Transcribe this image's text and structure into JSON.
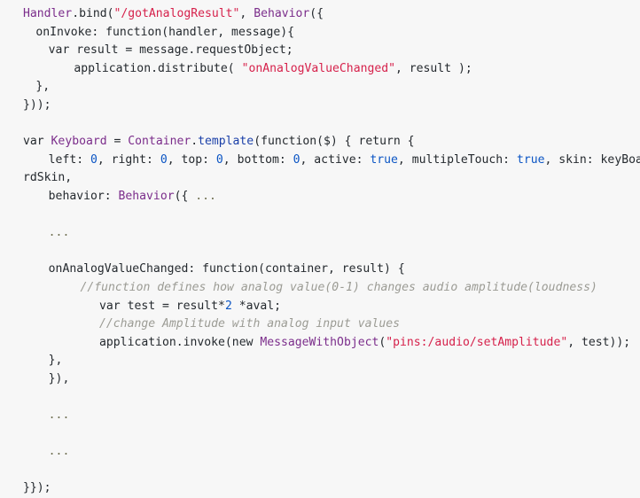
{
  "editor": {
    "background_color": "#f7f7f7",
    "font_size_px": 13,
    "language": "JavaScript"
  },
  "colors": {
    "plain": "#24292e",
    "type": "#7b2d8b",
    "method": "#1a3fa8",
    "string": "#d6214b",
    "number": "#0b55c4",
    "comment": "#9b9b94",
    "brace": "#5c5c2e"
  },
  "code": {
    "lines": [
      {
        "id": "line-1",
        "indent": 0,
        "tokens": [
          {
            "t": "Handler",
            "c": "type"
          },
          {
            "t": ".bind(",
            "c": "plain"
          },
          {
            "t": "\"/gotAnalogResult\"",
            "c": "string"
          },
          {
            "t": ", ",
            "c": "plain"
          },
          {
            "t": "Behavior",
            "c": "type"
          },
          {
            "t": "({",
            "c": "plain"
          }
        ]
      },
      {
        "id": "line-2",
        "indent": 2,
        "tokens": [
          {
            "t": "onInvoke: function(handler, message){",
            "c": "plain"
          }
        ]
      },
      {
        "id": "line-3",
        "indent": 4,
        "tokens": [
          {
            "t": "var result = message.requestObject;",
            "c": "plain"
          }
        ]
      },
      {
        "id": "line-4",
        "indent": 8,
        "tokens": [
          {
            "t": "application.distribute( ",
            "c": "plain"
          },
          {
            "t": "\"onAnalogValueChanged\"",
            "c": "string"
          },
          {
            "t": ", result );",
            "c": "plain"
          }
        ]
      },
      {
        "id": "line-5",
        "indent": 2,
        "tokens": [
          {
            "t": "},",
            "c": "plain"
          }
        ]
      },
      {
        "id": "line-6",
        "indent": 0,
        "tokens": [
          {
            "t": "}));",
            "c": "plain"
          }
        ]
      },
      {
        "id": "line-7",
        "indent": 0,
        "tokens": []
      },
      {
        "id": "line-8",
        "indent": 0,
        "tokens": [
          {
            "t": "var ",
            "c": "plain"
          },
          {
            "t": "Keyboard",
            "c": "type"
          },
          {
            "t": " = ",
            "c": "plain"
          },
          {
            "t": "Container",
            "c": "type"
          },
          {
            "t": ".",
            "c": "plain"
          },
          {
            "t": "template",
            "c": "method"
          },
          {
            "t": "(function($) { return {",
            "c": "plain"
          }
        ]
      },
      {
        "id": "line-9",
        "indent": 4,
        "tokens": [
          {
            "t": "left: ",
            "c": "plain"
          },
          {
            "t": "0",
            "c": "number"
          },
          {
            "t": ", right: ",
            "c": "plain"
          },
          {
            "t": "0",
            "c": "number"
          },
          {
            "t": ", top: ",
            "c": "plain"
          },
          {
            "t": "0",
            "c": "number"
          },
          {
            "t": ", bottom: ",
            "c": "plain"
          },
          {
            "t": "0",
            "c": "number"
          },
          {
            "t": ", active: ",
            "c": "plain"
          },
          {
            "t": "true",
            "c": "number"
          },
          {
            "t": ", multipleTouch: ",
            "c": "plain"
          },
          {
            "t": "true",
            "c": "number"
          },
          {
            "t": ", skin: keyBoa",
            "c": "plain"
          }
        ]
      },
      {
        "id": "line-10",
        "indent": 0,
        "tokens": [
          {
            "t": "rdSkin,",
            "c": "plain"
          }
        ]
      },
      {
        "id": "line-11",
        "indent": 4,
        "tokens": [
          {
            "t": "behavior: ",
            "c": "plain"
          },
          {
            "t": "Behavior",
            "c": "type"
          },
          {
            "t": "({ ",
            "c": "plain"
          },
          {
            "t": "...",
            "c": "dots"
          }
        ]
      },
      {
        "id": "line-12",
        "indent": 0,
        "tokens": []
      },
      {
        "id": "line-13",
        "indent": 4,
        "tokens": [
          {
            "t": "...",
            "c": "dots"
          }
        ]
      },
      {
        "id": "line-14",
        "indent": 0,
        "tokens": []
      },
      {
        "id": "line-15",
        "indent": 4,
        "tokens": [
          {
            "t": "onAnalogValueChanged: function(container, result) {",
            "c": "plain"
          }
        ]
      },
      {
        "id": "line-16",
        "indent": 9,
        "tokens": [
          {
            "t": "//function defines how analog value(0-1) changes audio amplitude(loudness)",
            "c": "comment"
          }
        ]
      },
      {
        "id": "line-17",
        "indent": 12,
        "tokens": [
          {
            "t": "var test = result*",
            "c": "plain"
          },
          {
            "t": "2",
            "c": "number"
          },
          {
            "t": " *aval;",
            "c": "plain"
          }
        ]
      },
      {
        "id": "line-18",
        "indent": 12,
        "tokens": [
          {
            "t": "//change Amplitude with analog input values",
            "c": "comment"
          }
        ]
      },
      {
        "id": "line-19",
        "indent": 12,
        "tokens": [
          {
            "t": "application.invoke(new ",
            "c": "plain"
          },
          {
            "t": "MessageWithObject",
            "c": "type"
          },
          {
            "t": "(",
            "c": "plain"
          },
          {
            "t": "\"pins:/audio/setAmplitude\"",
            "c": "string"
          },
          {
            "t": ", test));",
            "c": "plain"
          }
        ]
      },
      {
        "id": "line-20",
        "indent": 4,
        "tokens": [
          {
            "t": "},",
            "c": "plain"
          }
        ]
      },
      {
        "id": "line-21",
        "indent": 4,
        "tokens": [
          {
            "t": "}),",
            "c": "plain"
          }
        ]
      },
      {
        "id": "line-22",
        "indent": 0,
        "tokens": []
      },
      {
        "id": "line-23",
        "indent": 4,
        "tokens": [
          {
            "t": "...",
            "c": "dots"
          }
        ]
      },
      {
        "id": "line-24",
        "indent": 0,
        "tokens": []
      },
      {
        "id": "line-25",
        "indent": 4,
        "tokens": [
          {
            "t": "...",
            "c": "dots"
          }
        ]
      },
      {
        "id": "line-26",
        "indent": 0,
        "tokens": []
      },
      {
        "id": "line-27",
        "indent": 0,
        "tokens": [
          {
            "t": "}});",
            "c": "plain"
          }
        ]
      }
    ]
  }
}
